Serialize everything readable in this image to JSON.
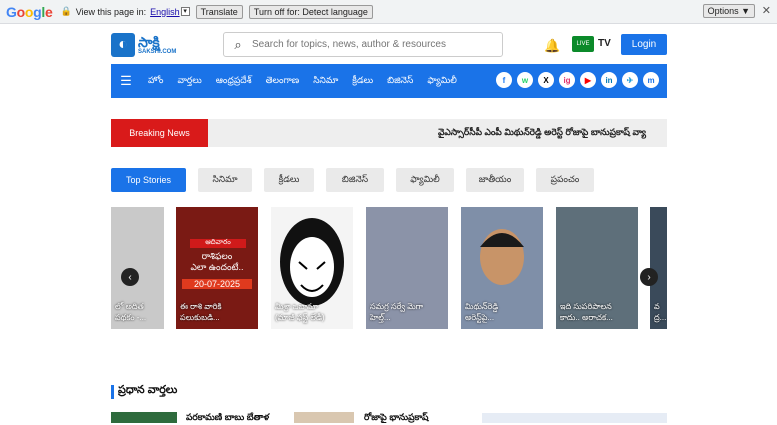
{
  "translate_bar": {
    "logo": "Google",
    "prefix": "View this page in:",
    "language": "English",
    "translate_label": "Translate",
    "turn_off_label": "Turn off for: Detect language",
    "options_label": "Options ▼",
    "close": "✕"
  },
  "header": {
    "logo_text": "సాక్షి",
    "logo_sub": "SAKSHI.COM",
    "search_placeholder": "Search for topics, news, author & resources",
    "live_label": "LIVE",
    "tv_label": "TV",
    "login_label": "Login"
  },
  "nav": {
    "items": [
      "హోం",
      "వార్తలు",
      "ఆంధ్రప్రదేశ్",
      "తెలంగాణ",
      "సినిమా",
      "క్రీడలు",
      "బిజినెస్",
      "ఫ్యామిలీ"
    ],
    "socials": [
      "f",
      "w",
      "X",
      "ig",
      "▶",
      "in",
      "✈",
      "m"
    ],
    "social_colors": [
      "#1877f2",
      "#25d366",
      "#000000",
      "#e1306c",
      "#ff0000",
      "#0077b5",
      "#229ed9",
      "#1a73e8"
    ]
  },
  "breaking": {
    "label": "Breaking News",
    "ticker": "వైఎస్సార్‌సీపీ ఎంపీ మిథున్‌రెడ్డి అరెస్ట్   రోజాపై బానుప్రకాష్ వ్యా"
  },
  "tabs": [
    {
      "label": "Top Stories",
      "active": true
    },
    {
      "label": "సినిమా",
      "active": false
    },
    {
      "label": "క్రీడలు",
      "active": false
    },
    {
      "label": "బిజినెస్",
      "active": false
    },
    {
      "label": "ఫ్యామిలీ",
      "active": false
    },
    {
      "label": "జాతీయం",
      "active": false
    },
    {
      "label": "ప్రపంచం",
      "active": false
    }
  ],
  "cards": [
    {
      "caption": "లో అదిత\nపథకం -...",
      "color": "#c9c9c9"
    },
    {
      "caption": "ఈ రాశి వారికి\nపలుకుబడి...",
      "color": "#7a1a14",
      "badge_top": "ఆదివారం",
      "badge_mid": "రాశిఫలం\nఎలా ఉందంటే..",
      "badge_date": "20-07-2025"
    },
    {
      "caption": "మిశ్రా ఒబామా\n(మాజీ ఫస్ట్ లేడీ)",
      "color": "#f4f4f4"
    },
    {
      "caption": "సమగ్ర సర్వే మెగా\nహెల్త్...",
      "color": "#8b93a8"
    },
    {
      "caption": "మిథున్‌రెడ్డి\nఅరెస్ట్‌పై...",
      "color": "#7f8fa8"
    },
    {
      "caption": "ఇది సుపరిపాలన\nకాదు.. అరాచక...",
      "color": "#5e6f7a"
    },
    {
      "caption": "వ\nద్ర...",
      "color": "#3a4a5a"
    }
  ],
  "section": {
    "title": "ప్రధాన వార్తలు",
    "item1": "పరకామణి బాబు బేతాళ",
    "item2": "రోజాపై భానుప్రకాష్"
  }
}
